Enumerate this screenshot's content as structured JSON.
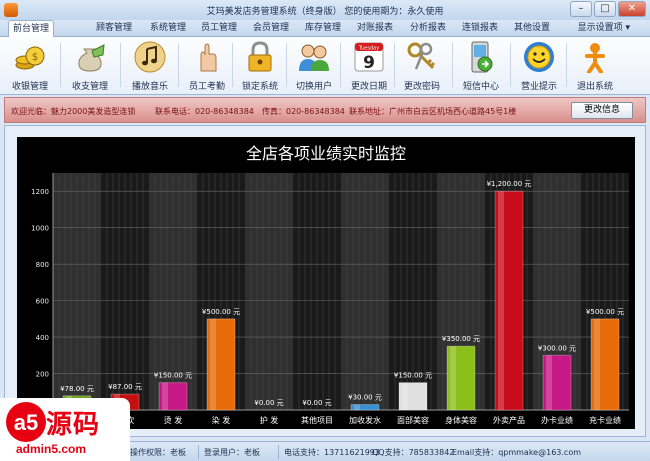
{
  "window": {
    "title": "艾玛美发店务管理系统（终身版）   您的使用期为：永久使用"
  },
  "menu": {
    "items": [
      "前台管理",
      "顾客管理",
      "系统管理",
      "员工管理",
      "会员管理",
      "库存管理",
      "对账报表",
      "分析报表",
      "连锁报表",
      "其他设置"
    ],
    "right": "显示设置项 ▾"
  },
  "toolbar": {
    "items": [
      {
        "label": "收银管理",
        "icon": "coins-icon"
      },
      {
        "label": "收支管理",
        "icon": "money-bag-icon"
      },
      {
        "label": "播放音乐",
        "icon": "music-note-icon"
      },
      {
        "label": "员工考勤",
        "icon": "fingerprint-hand-icon"
      },
      {
        "label": "锁定系统",
        "icon": "padlock-icon"
      },
      {
        "label": "切换用户",
        "icon": "users-icon"
      },
      {
        "label": "更改日期",
        "icon": "calendar-icon"
      },
      {
        "label": "更改密码",
        "icon": "keys-icon"
      },
      {
        "label": "短信中心",
        "icon": "mobile-phone-icon"
      },
      {
        "label": "营业提示",
        "icon": "smiley-icon"
      },
      {
        "label": "退出系统",
        "icon": "exit-icon"
      }
    ],
    "calendar_day": "Tuesday",
    "calendar_date": "9"
  },
  "info": {
    "welcome": "欢迎光临：魅力2000美发造型连锁",
    "phone": "联系电话：020-86348384",
    "fax": "传真：020-86348384",
    "address": "联系地址：广州市白云区机场西心道路45号1楼",
    "button": "更改信息"
  },
  "chart_data": {
    "type": "bar",
    "title": "全店各项业绩实时监控",
    "categories": [
      "洗 吹",
      "剪 吹",
      "烫 发",
      "染 发",
      "护 发",
      "其他项目",
      "加收发水",
      "面部美容",
      "身体美容",
      "外卖产品",
      "办卡业绩",
      "充卡业绩"
    ],
    "values": [
      78,
      87,
      150,
      500,
      0,
      0,
      30,
      150,
      350,
      1200,
      300,
      500
    ],
    "value_labels": [
      "¥78.00 元",
      "¥87.00 元",
      "¥150.00 元",
      "¥500.00 元",
      "¥0.00 元",
      "¥0.00 元",
      "¥30.00 元",
      "¥150.00 元",
      "¥350.00 元",
      "¥1,200.00 元",
      "¥300.00 元",
      "¥500.00 元"
    ],
    "colors": [
      "#6fa020",
      "#c41010",
      "#c81885",
      "#e86b0a",
      "#666666",
      "#666666",
      "#3a8fd0",
      "#e0e0e0",
      "#8cbf1a",
      "#c80c1c",
      "#c81885",
      "#e86b0a"
    ],
    "yticks": [
      200,
      400,
      600,
      800,
      1000,
      1200
    ],
    "ylim": [
      0,
      1300
    ],
    "grid": true
  },
  "status": {
    "permission": "操作权限：老板",
    "user": "登录用户：老板",
    "phone": "电话支持：13711621993",
    "qq": "QQ支持：785833842",
    "email": "Email支持：qpmmake@163.com"
  },
  "watermark": {
    "mark": "a5",
    "cn": "源码",
    "en": "admin5.com"
  }
}
